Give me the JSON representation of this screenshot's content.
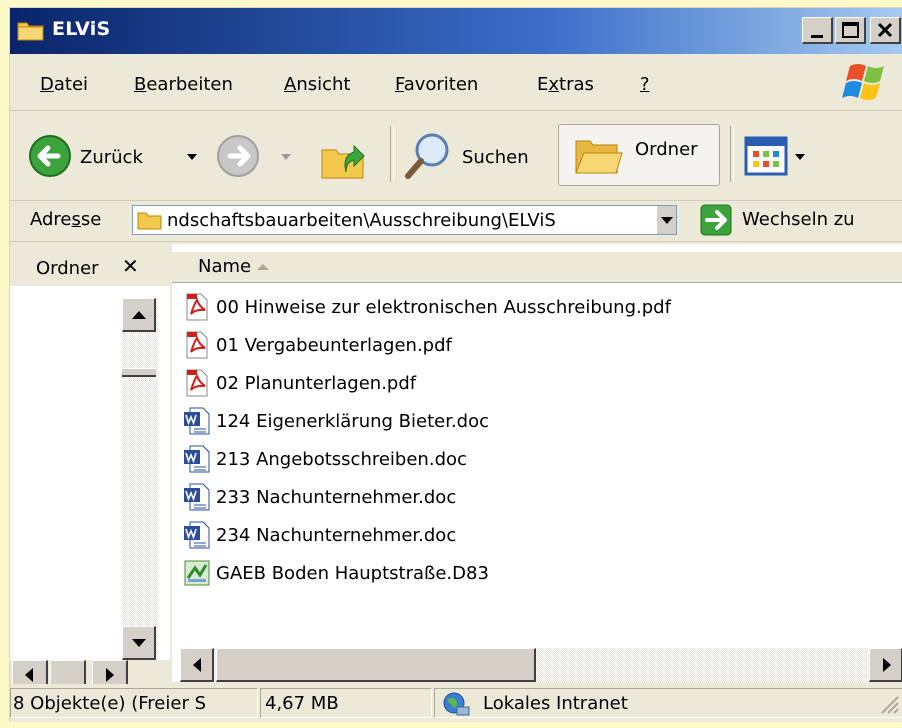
{
  "window": {
    "title": "ELViS",
    "title_icon": "folder-icon",
    "controls": [
      "minimize-icon",
      "maximize-icon",
      "close-icon"
    ]
  },
  "menu": {
    "items": [
      {
        "label": "Datei",
        "accel": "D"
      },
      {
        "label": "Bearbeiten",
        "accel": "B"
      },
      {
        "label": "Ansicht",
        "accel": "A"
      },
      {
        "label": "Favoriten",
        "accel": "F"
      },
      {
        "label": "Extras",
        "accel": "x"
      },
      {
        "label": "?",
        "accel": "?"
      }
    ]
  },
  "toolbar": {
    "back_label": "Zurück",
    "search_label": "Suchen",
    "folders_label": "Ordner"
  },
  "address": {
    "label": "Adresse",
    "value": "ndschaftsbauarbeiten\\Ausschreibung\\ELViS",
    "go_label": "Wechseln zu"
  },
  "folders_pane": {
    "title": "Ordner",
    "close_glyph": "✕"
  },
  "file_list": {
    "column_name": "Name",
    "files": [
      {
        "name": "00 Hinweise zur elektronischen Ausschreibung.pdf",
        "icon": "pdf-icon"
      },
      {
        "name": "01 Vergabeunterlagen.pdf",
        "icon": "pdf-icon"
      },
      {
        "name": "02 Planunterlagen.pdf",
        "icon": "pdf-icon"
      },
      {
        "name": "124 Eigenerklärung Bieter.doc",
        "icon": "word-doc-icon"
      },
      {
        "name": "213 Angebotsschreiben.doc",
        "icon": "word-doc-icon"
      },
      {
        "name": "233 Nachunternehmer.doc",
        "icon": "word-doc-icon"
      },
      {
        "name": "234 Nachunternehmer.doc",
        "icon": "word-doc-icon"
      },
      {
        "name": "GAEB Boden Hauptstraße.D83",
        "icon": "gaeb-file-icon"
      }
    ]
  },
  "status": {
    "objects": "8 Objekte(e) (Freier S",
    "size": "4,67 MB",
    "zone": "Lokales Intranet"
  },
  "colors": {
    "title_bar_start": "#0a246a",
    "title_bar_end": "#a6caf0",
    "chrome": "#ece9d8",
    "page_background": "#fdf9c9"
  }
}
